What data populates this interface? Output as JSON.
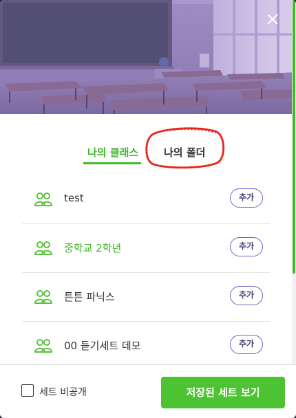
{
  "header": {
    "banner_image": "classroom-photo",
    "close_icon": "close-icon"
  },
  "tabs": [
    {
      "label": "나의 클래스",
      "active": true
    },
    {
      "label": "나의 폴더",
      "active": false
    }
  ],
  "class_list": [
    {
      "name": "test",
      "action": "추가",
      "highlighted": false,
      "icon": "group-icon"
    },
    {
      "name": "중학교 2학년",
      "action": "추가",
      "highlighted": true,
      "icon": "group-icon"
    },
    {
      "name": "튼튼 파닉스",
      "action": "추가",
      "highlighted": false,
      "icon": "group-icon"
    },
    {
      "name": "00 듣기세트 데모",
      "action": "추가",
      "highlighted": false,
      "icon": "group-icon"
    }
  ],
  "footer": {
    "private_checkbox_label": "세트 비공개",
    "private_checked": false,
    "view_saved_button": "저장된 세트 보기"
  },
  "colors": {
    "accent_green": "#44b82c",
    "button_green": "#4dc233",
    "add_button_border": "#7b5ec2",
    "annotation_red": "#e8261c"
  }
}
